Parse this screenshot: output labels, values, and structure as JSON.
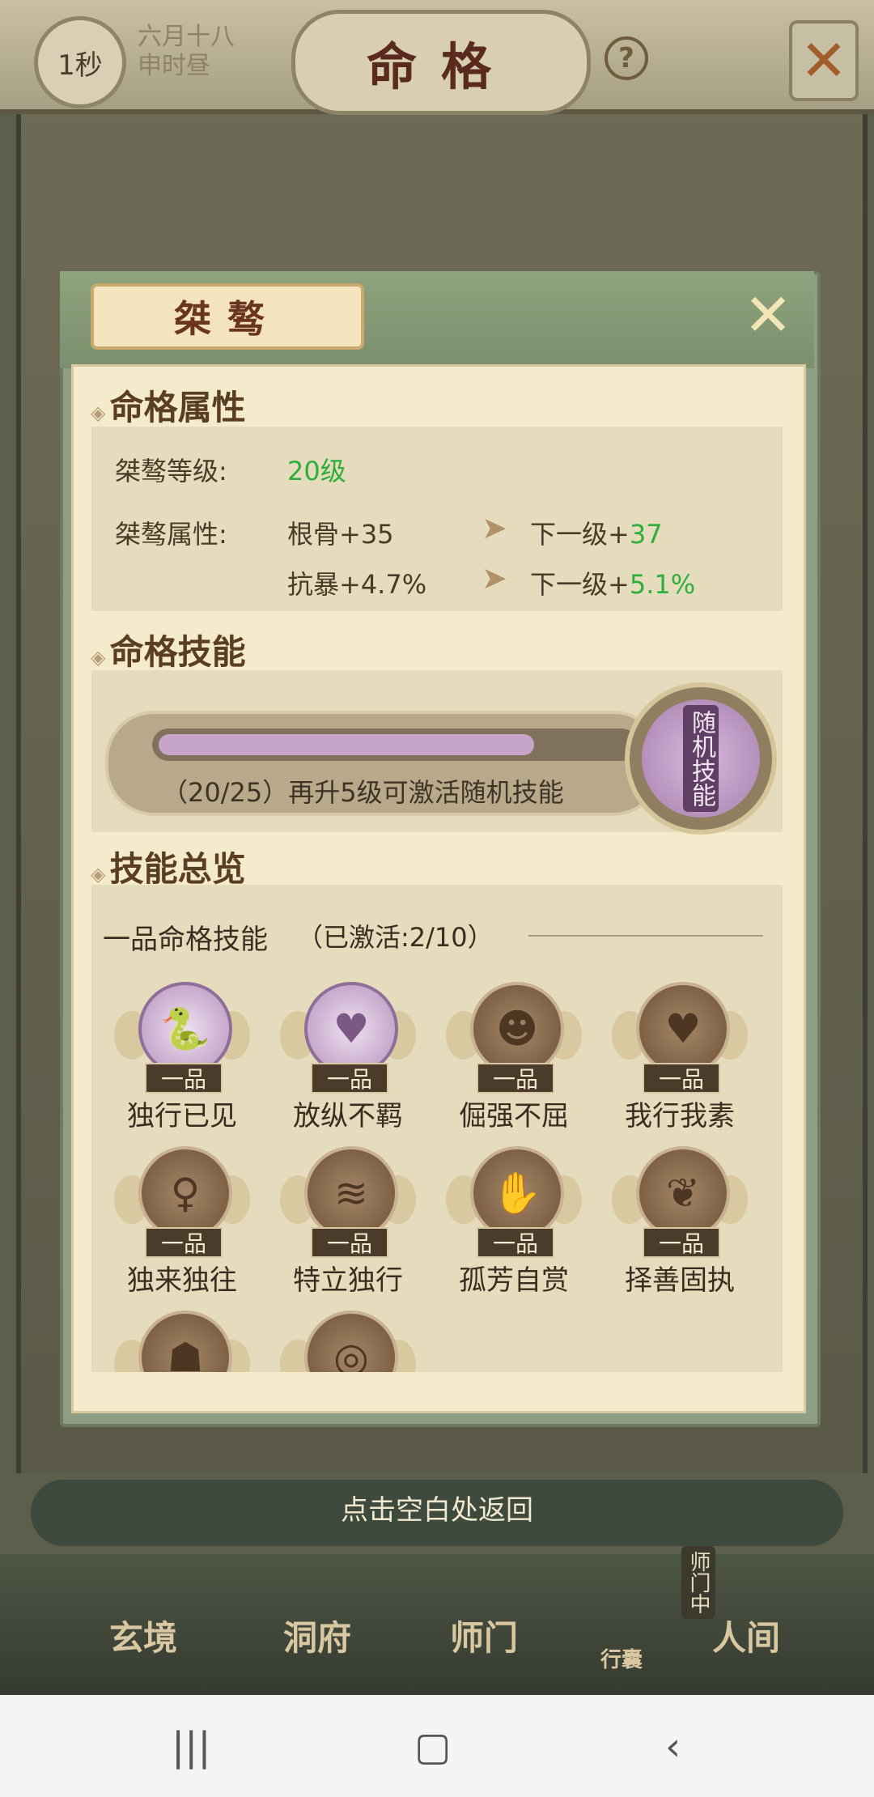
{
  "topbar": {
    "timer": "1秒",
    "date_line1": "六月十八",
    "date_line2": "申时昼",
    "title": "命格",
    "help_label": "?"
  },
  "modal": {
    "name": "桀骜",
    "close_icon": "close-icon",
    "attributes": {
      "section_title": "命格属性",
      "level_label": "桀骜等级:",
      "level_value": "20级",
      "attr_label": "桀骜属性:",
      "rows": [
        {
          "stat": "根骨+35",
          "next_prefix": "下一级+",
          "next_value": "37"
        },
        {
          "stat": "抗暴+4.7%",
          "next_prefix": "下一级+",
          "next_value": "5.1%"
        }
      ]
    },
    "skill": {
      "section_title": "命格技能",
      "progress_current": 20,
      "progress_max": 25,
      "progress_text": "（20/25）再升5级可激活随机技能",
      "random_skill_label": "随机技能"
    },
    "overview": {
      "section_title": "技能总览",
      "group_title": "一品命格技能",
      "group_status": "（已激活:2/10）",
      "tier_label": "一品",
      "skills": [
        {
          "name": "独行已见",
          "icon": "snake-icon",
          "active": true
        },
        {
          "name": "放纵不羁",
          "icon": "fox-icon",
          "active": true
        },
        {
          "name": "倔强不屈",
          "icon": "lion-icon",
          "active": false
        },
        {
          "name": "我行我素",
          "icon": "heart-icon",
          "active": false
        },
        {
          "name": "独来独往",
          "icon": "dancer-icon",
          "active": false
        },
        {
          "name": "特立独行",
          "icon": "feather-icon",
          "active": false
        },
        {
          "name": "孤芳自赏",
          "icon": "hand-icon",
          "active": false
        },
        {
          "name": "择善固执",
          "icon": "crane-icon",
          "active": false
        },
        {
          "name": "",
          "icon": "bear-icon",
          "active": false
        },
        {
          "name": "",
          "icon": "swirl-icon",
          "active": false
        }
      ]
    }
  },
  "return_hint": "点击空白处返回",
  "bottom_nav": {
    "xuanjing": "玄境",
    "dongfu": "洞府",
    "shimen": "师门",
    "xingnang": "行囊",
    "renjian": "人间",
    "shimen_zhong": "师门中"
  },
  "colors": {
    "accent_green": "#2eae3b",
    "progress_fill": "#c7a4c9"
  }
}
